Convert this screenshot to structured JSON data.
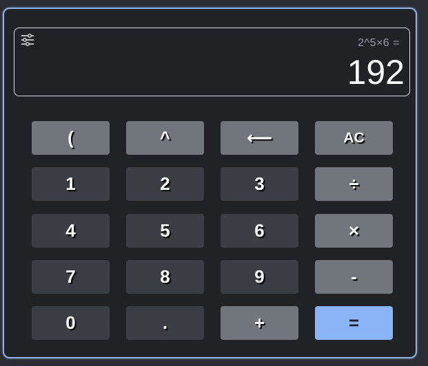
{
  "display": {
    "expression": "2^5×6 =",
    "result": "192"
  },
  "icons": {
    "settings": "sliders-icon"
  },
  "colors": {
    "frame_border": "#8fb2e8",
    "background": "#202226",
    "digit_button": "#3b3e43",
    "operator_button": "#71767c",
    "equals_button": "#8ab4f8"
  },
  "keys": {
    "open_paren": "(",
    "power": "^",
    "backspace": "⟵",
    "clear": "AC",
    "one": "1",
    "two": "2",
    "three": "3",
    "divide": "÷",
    "four": "4",
    "five": "5",
    "six": "6",
    "multiply": "×",
    "seven": "7",
    "eight": "8",
    "nine": "9",
    "subtract": "-",
    "zero": "0",
    "decimal": ".",
    "add": "+",
    "equals": "="
  }
}
